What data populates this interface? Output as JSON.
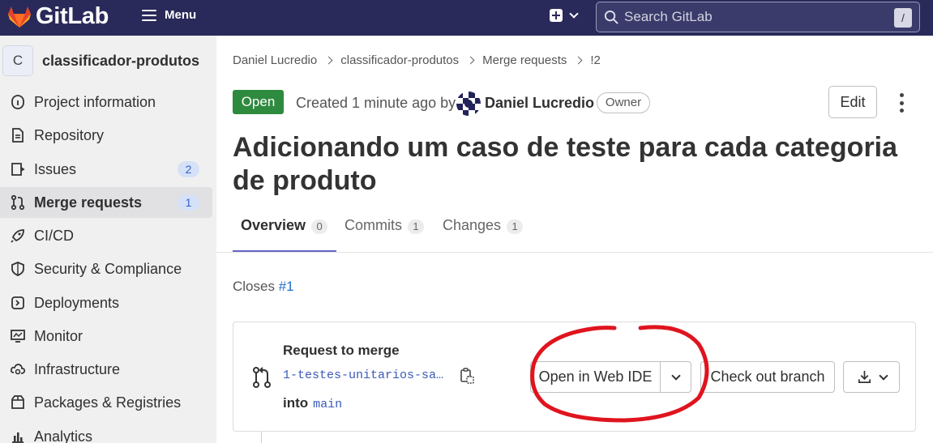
{
  "topbar": {
    "logo_text": "GitLab",
    "menu_label": "Menu",
    "search_placeholder": "Search GitLab",
    "search_shortcut": "/",
    "icons": {
      "logo": "gitlab-tanuki-icon",
      "menu": "hamburger-icon",
      "new": "plus-square-icon",
      "search": "search-icon"
    }
  },
  "sidebar": {
    "project_initial": "C",
    "project_name": "classificador-produtos",
    "items": [
      {
        "label": "Project information",
        "icon": "info-circle-icon",
        "badge": null,
        "active": false
      },
      {
        "label": "Repository",
        "icon": "doc-text-icon",
        "badge": null,
        "active": false
      },
      {
        "label": "Issues",
        "icon": "issues-icon",
        "badge": "2",
        "active": false
      },
      {
        "label": "Merge requests",
        "icon": "merge-request-icon",
        "badge": "1",
        "active": true
      },
      {
        "label": "CI/CD",
        "icon": "rocket-icon",
        "badge": null,
        "active": false
      },
      {
        "label": "Security & Compliance",
        "icon": "shield-icon",
        "badge": null,
        "active": false
      },
      {
        "label": "Deployments",
        "icon": "deployments-icon",
        "badge": null,
        "active": false
      },
      {
        "label": "Monitor",
        "icon": "monitor-icon",
        "badge": null,
        "active": false
      },
      {
        "label": "Infrastructure",
        "icon": "cloud-gear-icon",
        "badge": null,
        "active": false
      },
      {
        "label": "Packages & Registries",
        "icon": "package-icon",
        "badge": null,
        "active": false
      },
      {
        "label": "Analytics",
        "icon": "chart-icon",
        "badge": null,
        "active": false
      }
    ]
  },
  "breadcrumb": [
    "Daniel Lucredio",
    "classificador-produtos",
    "Merge requests",
    "!2"
  ],
  "mr": {
    "status": "Open",
    "created_text": "Created 1 minute ago by",
    "author": "Daniel Lucredio",
    "author_role": "Owner",
    "edit_label": "Edit",
    "title": "Adicionando um caso de teste para cada categoria de produto",
    "status_color": "#2e8a3f"
  },
  "tabs": [
    {
      "label": "Overview",
      "count": "0",
      "active": true
    },
    {
      "label": "Commits",
      "count": "1",
      "active": false
    },
    {
      "label": "Changes",
      "count": "1",
      "active": false
    }
  ],
  "closes": {
    "prefix": "Closes",
    "issue": "#1"
  },
  "merge_widget": {
    "heading": "Request to merge",
    "source_branch": "1-testes-unitarios-sa…",
    "into_label": "into",
    "target_branch": "main",
    "open_web_ide_label": "Open in Web IDE",
    "checkout_label": "Check out branch"
  },
  "annotation": {
    "shape": "hand-drawn-ellipse",
    "color": "#e0141e"
  }
}
